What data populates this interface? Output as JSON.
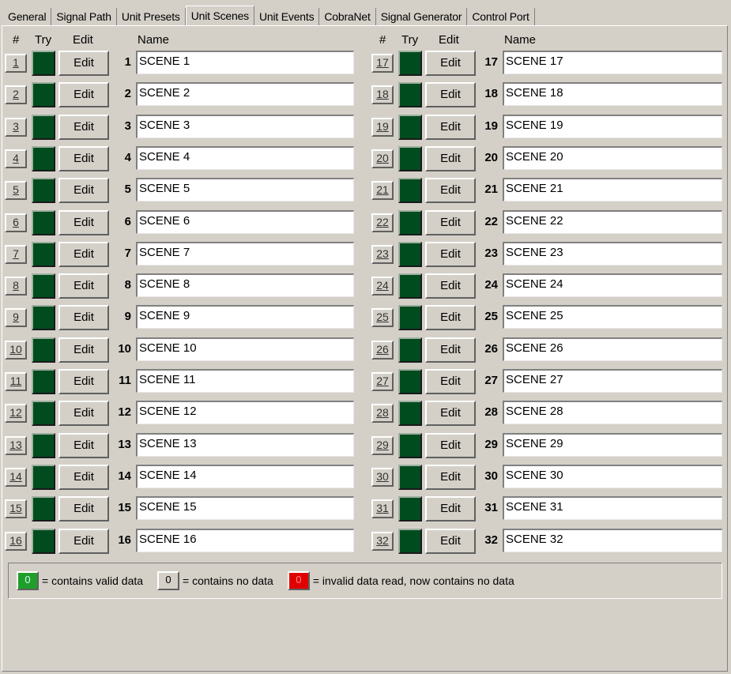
{
  "tabs": [
    "General",
    "Signal Path",
    "Unit Presets",
    "Unit Scenes",
    "Unit Events",
    "CobraNet",
    "Signal Generator",
    "Control Port"
  ],
  "active_tab": "Unit Scenes",
  "columns": {
    "num": "#",
    "try": "Try",
    "edit": "Edit",
    "name": "Name"
  },
  "edit_label": "Edit",
  "colors": {
    "try_active": "#004c1e",
    "valid": "#1f9e2a",
    "invalid": "#e00000"
  },
  "scenes": [
    {
      "num": "1",
      "name": "SCENE 1"
    },
    {
      "num": "2",
      "name": "SCENE 2"
    },
    {
      "num": "3",
      "name": "SCENE 3"
    },
    {
      "num": "4",
      "name": "SCENE 4"
    },
    {
      "num": "5",
      "name": "SCENE 5"
    },
    {
      "num": "6",
      "name": "SCENE 6"
    },
    {
      "num": "7",
      "name": "SCENE 7"
    },
    {
      "num": "8",
      "name": "SCENE 8"
    },
    {
      "num": "9",
      "name": "SCENE 9"
    },
    {
      "num": "10",
      "name": "SCENE 10"
    },
    {
      "num": "11",
      "name": "SCENE 11"
    },
    {
      "num": "12",
      "name": "SCENE 12"
    },
    {
      "num": "13",
      "name": "SCENE 13"
    },
    {
      "num": "14",
      "name": "SCENE 14"
    },
    {
      "num": "15",
      "name": "SCENE 15"
    },
    {
      "num": "16",
      "name": "SCENE 16"
    },
    {
      "num": "17",
      "name": "SCENE 17"
    },
    {
      "num": "18",
      "name": "SCENE 18"
    },
    {
      "num": "19",
      "name": "SCENE 19"
    },
    {
      "num": "20",
      "name": "SCENE 20"
    },
    {
      "num": "21",
      "name": "SCENE 21"
    },
    {
      "num": "22",
      "name": "SCENE 22"
    },
    {
      "num": "23",
      "name": "SCENE 23"
    },
    {
      "num": "24",
      "name": "SCENE 24"
    },
    {
      "num": "25",
      "name": "SCENE 25"
    },
    {
      "num": "26",
      "name": "SCENE 26"
    },
    {
      "num": "27",
      "name": "SCENE 27"
    },
    {
      "num": "28",
      "name": "SCENE 28"
    },
    {
      "num": "29",
      "name": "SCENE 29"
    },
    {
      "num": "30",
      "name": "SCENE 30"
    },
    {
      "num": "31",
      "name": "SCENE 31"
    },
    {
      "num": "32",
      "name": "SCENE 32"
    }
  ],
  "legend": {
    "valid_swatch": "0",
    "valid_text": "= contains valid data",
    "empty_swatch": "0",
    "empty_text": "= contains no data",
    "invalid_swatch": "0",
    "invalid_text": "= invalid data read, now contains no data"
  }
}
